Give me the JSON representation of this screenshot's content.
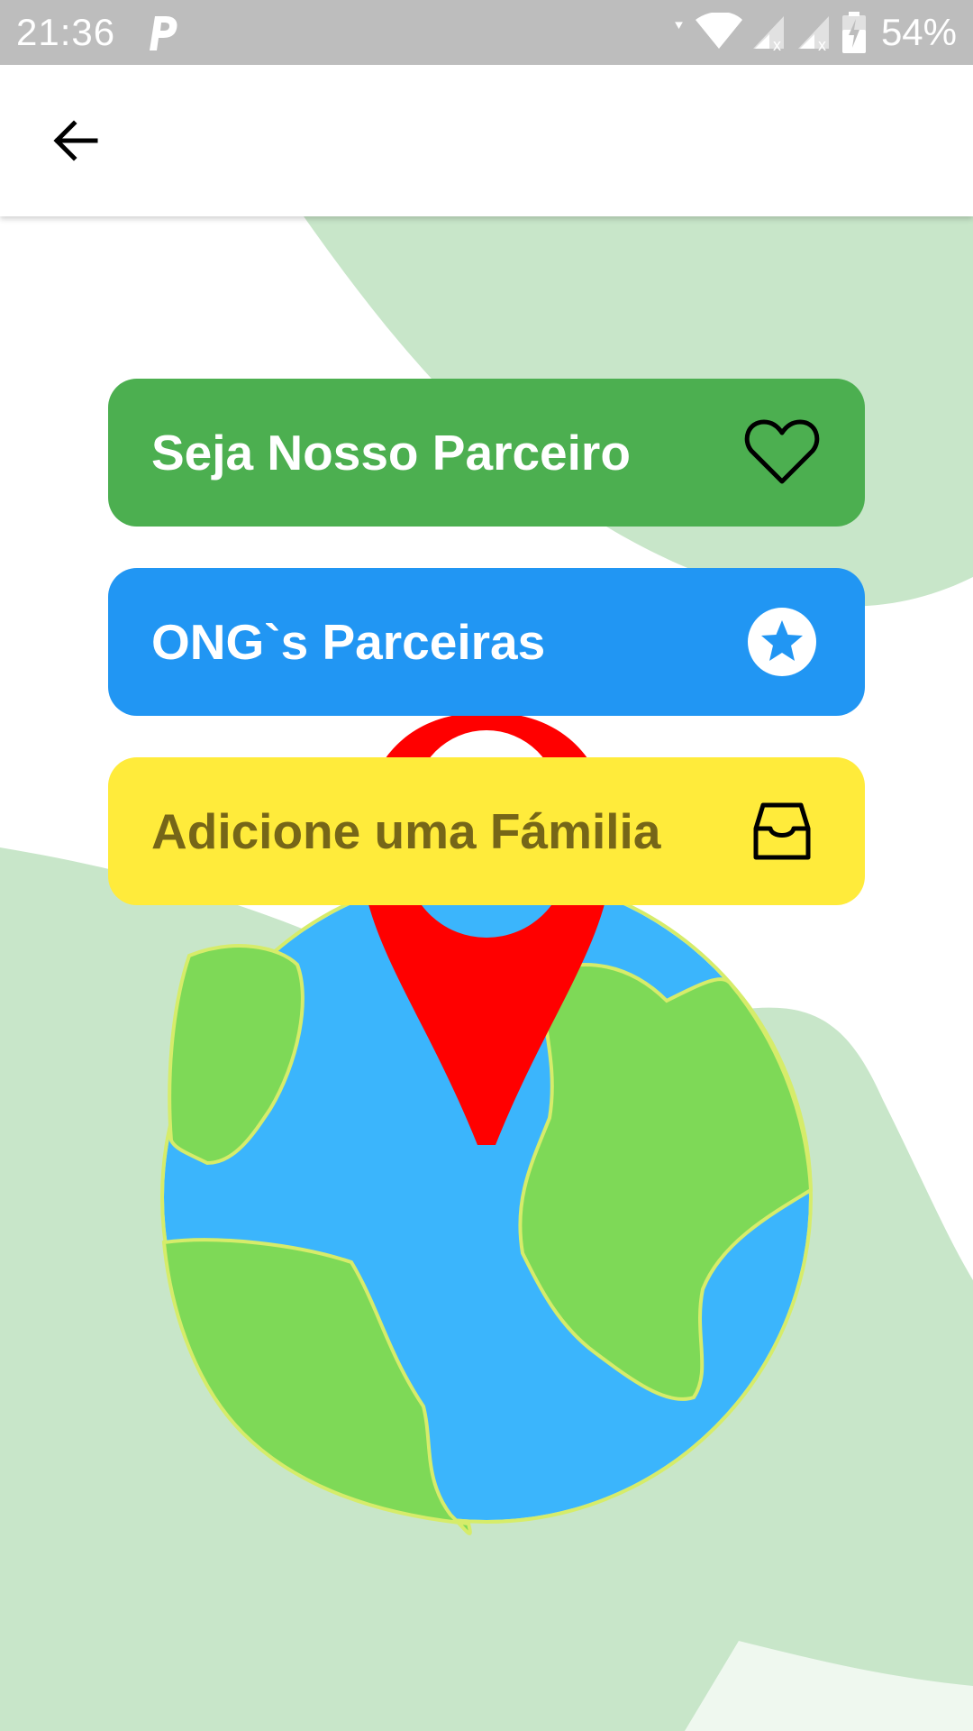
{
  "status_bar": {
    "time": "21:36",
    "battery_percent": "54%",
    "icons": [
      "parking-icon",
      "wifi-icon",
      "signal-icon",
      "signal-icon",
      "battery-charging-icon"
    ]
  },
  "app_bar": {
    "back_icon": "arrow-left-icon"
  },
  "menu": [
    {
      "label": "Seja Nosso Parceiro",
      "icon": "heart-outline-icon",
      "color": "#4caf50",
      "text_color": "#ffffff"
    },
    {
      "label": "ONG`s Parceiras",
      "icon": "star-circle-icon",
      "color": "#2196f3",
      "text_color": "#ffffff"
    },
    {
      "label": "Adicione uma Fámilia",
      "icon": "inbox-tray-icon",
      "color": "#ffeb3b",
      "text_color": "#766618"
    }
  ],
  "illustration": {
    "type": "globe-with-location-pin",
    "ocean_color": "#3bb5fc",
    "land_color": "#7ed957",
    "pin_color": "#ff0000",
    "background_blob_color": "#c8e6c9"
  }
}
